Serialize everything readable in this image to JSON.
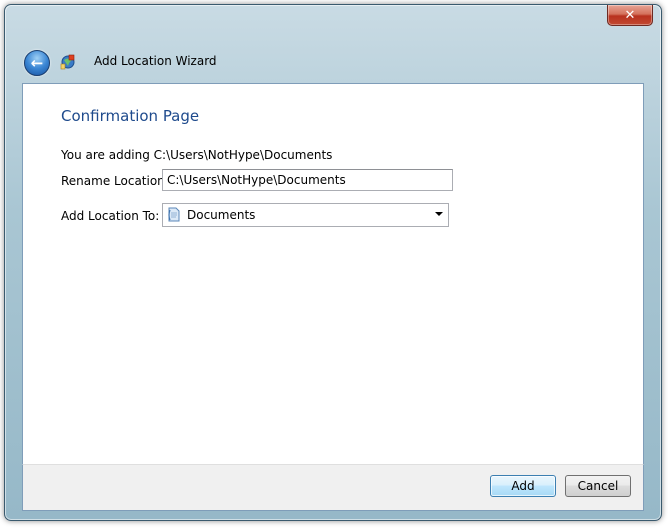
{
  "window": {
    "title": "Add Location Wizard",
    "close_symbol": "✕"
  },
  "page": {
    "heading": "Confirmation Page",
    "adding_text": "You are adding C:\\Users\\NotHype\\Documents",
    "rename_label": "Rename Location:",
    "rename_value": "C:\\Users\\NotHype\\Documents",
    "add_to_label": "Add Location To:",
    "add_to_value": "Documents"
  },
  "buttons": {
    "add": "Add",
    "cancel": "Cancel"
  },
  "icons": {
    "back": "back-arrow-icon",
    "wizard": "wizard-globe-icon",
    "documents": "documents-library-icon",
    "dropdown": "chevron-down-icon"
  },
  "colors": {
    "heading": "#1e4a8c",
    "close_button": "#c24a32",
    "default_button_border": "#3c7fb1"
  }
}
